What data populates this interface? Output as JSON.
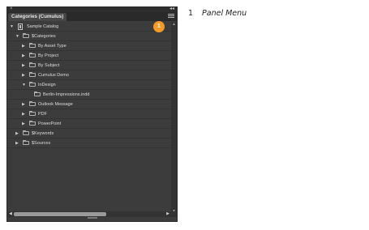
{
  "panel": {
    "tab_label": "Categories (Cumulus)",
    "close_glyph": "×",
    "collapse_glyph": "◂◂",
    "badge_number": "1"
  },
  "tree": [
    {
      "label": "Sample Catalog",
      "expanded": true,
      "icon": "catalog-icon"
    },
    {
      "label": "$Categories",
      "expanded": true,
      "icon": "folder-open-icon"
    },
    {
      "label": "By Asset Type",
      "expanded": false,
      "icon": "folder-icon"
    },
    {
      "label": "By Project",
      "expanded": false,
      "icon": "folder-icon"
    },
    {
      "label": "By Subject",
      "expanded": false,
      "icon": "folder-icon"
    },
    {
      "label": "Cumulus Demo",
      "expanded": false,
      "icon": "folder-icon"
    },
    {
      "label": "InDesign",
      "expanded": true,
      "icon": "folder-open-icon"
    },
    {
      "label": "Berlin-Impressions.indd",
      "expanded": null,
      "icon": "folder-icon"
    },
    {
      "label": "Outlook Message",
      "expanded": false,
      "icon": "folder-icon"
    },
    {
      "label": "PDF",
      "expanded": false,
      "icon": "folder-icon"
    },
    {
      "label": "PowerPoint",
      "expanded": false,
      "icon": "folder-icon"
    },
    {
      "label": "$Keywords",
      "expanded": false,
      "icon": "folder-icon"
    },
    {
      "label": "$Sources",
      "expanded": false,
      "icon": "folder-icon"
    }
  ],
  "callout": {
    "number": "1",
    "text": "Panel Menu"
  }
}
